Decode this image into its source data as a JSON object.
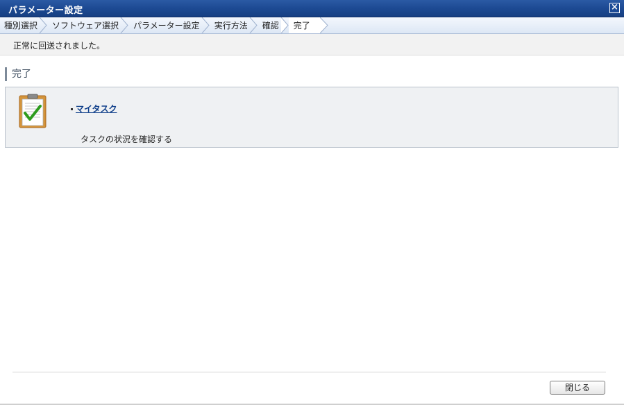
{
  "window": {
    "title": "パラメーター設定",
    "close_icon": "close-icon"
  },
  "steps": [
    {
      "label": "種別選択",
      "current": false
    },
    {
      "label": "ソフトウェア選択",
      "current": false
    },
    {
      "label": "パラメーター設定",
      "current": false
    },
    {
      "label": "実行方法",
      "current": false
    },
    {
      "label": "確認",
      "current": false
    },
    {
      "label": "完了",
      "current": true
    }
  ],
  "message": "正常に回送されました。",
  "section": {
    "heading": "完了"
  },
  "panel": {
    "icon": "clipboard-check-icon",
    "link_label": "マイタスク",
    "description": "タスクの状況を確認する"
  },
  "footer": {
    "close_label": "閉じる"
  },
  "colors": {
    "titlebar": "#1d4a93",
    "link": "#0f3f8a",
    "check": "#2e9c1e"
  }
}
